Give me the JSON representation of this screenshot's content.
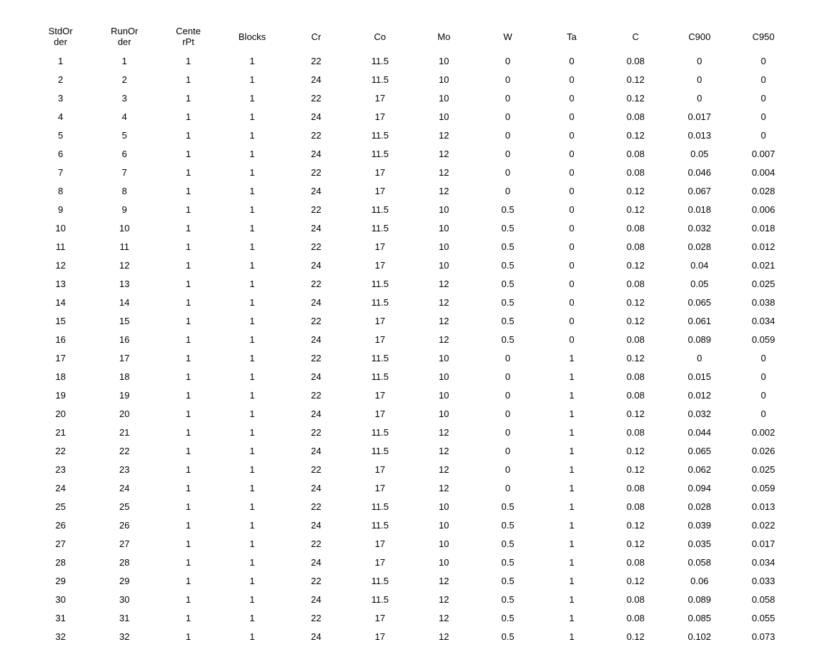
{
  "table": {
    "headers": [
      "StdOr\nder",
      "RunOr\nder",
      "Cente\nrPt",
      "Blocks",
      "Cr",
      "Co",
      "Mo",
      "W",
      "Ta",
      "C",
      "C900",
      "C950"
    ],
    "rows": [
      [
        "1",
        "1",
        "1",
        "1",
        "22",
        "11.5",
        "10",
        "0",
        "0",
        "0.08",
        "0",
        "0"
      ],
      [
        "2",
        "2",
        "1",
        "1",
        "24",
        "11.5",
        "10",
        "0",
        "0",
        "0.12",
        "0",
        "0"
      ],
      [
        "3",
        "3",
        "1",
        "1",
        "22",
        "17",
        "10",
        "0",
        "0",
        "0.12",
        "0",
        "0"
      ],
      [
        "4",
        "4",
        "1",
        "1",
        "24",
        "17",
        "10",
        "0",
        "0",
        "0.08",
        "0.017",
        "0"
      ],
      [
        "5",
        "5",
        "1",
        "1",
        "22",
        "11.5",
        "12",
        "0",
        "0",
        "0.12",
        "0.013",
        "0"
      ],
      [
        "6",
        "6",
        "1",
        "1",
        "24",
        "11.5",
        "12",
        "0",
        "0",
        "0.08",
        "0.05",
        "0.007"
      ],
      [
        "7",
        "7",
        "1",
        "1",
        "22",
        "17",
        "12",
        "0",
        "0",
        "0.08",
        "0.046",
        "0.004"
      ],
      [
        "8",
        "8",
        "1",
        "1",
        "24",
        "17",
        "12",
        "0",
        "0",
        "0.12",
        "0.067",
        "0.028"
      ],
      [
        "9",
        "9",
        "1",
        "1",
        "22",
        "11.5",
        "10",
        "0.5",
        "0",
        "0.12",
        "0.018",
        "0.006"
      ],
      [
        "10",
        "10",
        "1",
        "1",
        "24",
        "11.5",
        "10",
        "0.5",
        "0",
        "0.08",
        "0.032",
        "0.018"
      ],
      [
        "11",
        "11",
        "1",
        "1",
        "22",
        "17",
        "10",
        "0.5",
        "0",
        "0.08",
        "0.028",
        "0.012"
      ],
      [
        "12",
        "12",
        "1",
        "1",
        "24",
        "17",
        "10",
        "0.5",
        "0",
        "0.12",
        "0.04",
        "0.021"
      ],
      [
        "13",
        "13",
        "1",
        "1",
        "22",
        "11.5",
        "12",
        "0.5",
        "0",
        "0.08",
        "0.05",
        "0.025"
      ],
      [
        "14",
        "14",
        "1",
        "1",
        "24",
        "11.5",
        "12",
        "0.5",
        "0",
        "0.12",
        "0.065",
        "0.038"
      ],
      [
        "15",
        "15",
        "1",
        "1",
        "22",
        "17",
        "12",
        "0.5",
        "0",
        "0.12",
        "0.061",
        "0.034"
      ],
      [
        "16",
        "16",
        "1",
        "1",
        "24",
        "17",
        "12",
        "0.5",
        "0",
        "0.08",
        "0.089",
        "0.059"
      ],
      [
        "17",
        "17",
        "1",
        "1",
        "22",
        "11.5",
        "10",
        "0",
        "1",
        "0.12",
        "0",
        "0"
      ],
      [
        "18",
        "18",
        "1",
        "1",
        "24",
        "11.5",
        "10",
        "0",
        "1",
        "0.08",
        "0.015",
        "0"
      ],
      [
        "19",
        "19",
        "1",
        "1",
        "22",
        "17",
        "10",
        "0",
        "1",
        "0.08",
        "0.012",
        "0"
      ],
      [
        "20",
        "20",
        "1",
        "1",
        "24",
        "17",
        "10",
        "0",
        "1",
        "0.12",
        "0.032",
        "0"
      ],
      [
        "21",
        "21",
        "1",
        "1",
        "22",
        "11.5",
        "12",
        "0",
        "1",
        "0.08",
        "0.044",
        "0.002"
      ],
      [
        "22",
        "22",
        "1",
        "1",
        "24",
        "11.5",
        "12",
        "0",
        "1",
        "0.12",
        "0.065",
        "0.026"
      ],
      [
        "23",
        "23",
        "1",
        "1",
        "22",
        "17",
        "12",
        "0",
        "1",
        "0.12",
        "0.062",
        "0.025"
      ],
      [
        "24",
        "24",
        "1",
        "1",
        "24",
        "17",
        "12",
        "0",
        "1",
        "0.08",
        "0.094",
        "0.059"
      ],
      [
        "25",
        "25",
        "1",
        "1",
        "22",
        "11.5",
        "10",
        "0.5",
        "1",
        "0.08",
        "0.028",
        "0.013"
      ],
      [
        "26",
        "26",
        "1",
        "1",
        "24",
        "11.5",
        "10",
        "0.5",
        "1",
        "0.12",
        "0.039",
        "0.022"
      ],
      [
        "27",
        "27",
        "1",
        "1",
        "22",
        "17",
        "10",
        "0.5",
        "1",
        "0.12",
        "0.035",
        "0.017"
      ],
      [
        "28",
        "28",
        "1",
        "1",
        "24",
        "17",
        "10",
        "0.5",
        "1",
        "0.08",
        "0.058",
        "0.034"
      ],
      [
        "29",
        "29",
        "1",
        "1",
        "22",
        "11.5",
        "12",
        "0.5",
        "1",
        "0.12",
        "0.06",
        "0.033"
      ],
      [
        "30",
        "30",
        "1",
        "1",
        "24",
        "11.5",
        "12",
        "0.5",
        "1",
        "0.08",
        "0.089",
        "0.058"
      ],
      [
        "31",
        "31",
        "1",
        "1",
        "22",
        "17",
        "12",
        "0.5",
        "1",
        "0.08",
        "0.085",
        "0.055"
      ],
      [
        "32",
        "32",
        "1",
        "1",
        "24",
        "17",
        "12",
        "0.5",
        "1",
        "0.12",
        "0.102",
        "0.073"
      ]
    ]
  }
}
